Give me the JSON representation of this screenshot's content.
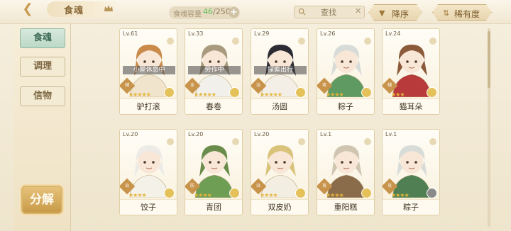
{
  "header": {
    "title": "食魂",
    "capacity_label": "食魂容量",
    "capacity_current": "46",
    "capacity_total": "/250",
    "search_text": "查找",
    "sort_order_label": "降序",
    "sort_rarity_label": "稀有度"
  },
  "sidebar": {
    "tabs": [
      {
        "label": "食魂",
        "active": true
      },
      {
        "label": "调理",
        "active": false
      },
      {
        "label": "信物",
        "active": false
      }
    ],
    "decompose_label": "分解"
  },
  "cards": [
    {
      "level": "Lv.61",
      "name": "驴打滚",
      "status": "小屋休息中",
      "role": "辅",
      "stars": "★★★★★",
      "rank_color": "#e5c15a",
      "hair": "#c98a4a",
      "outfit": "#f0e4cc"
    },
    {
      "level": "Lv.33",
      "name": "春卷",
      "status": "劳作中",
      "role": "全",
      "stars": "★★★★★",
      "rank_color": "#e5c15a",
      "hair": "#a89a7c",
      "outfit": "#f1f0ea"
    },
    {
      "level": "Lv.29",
      "name": "汤圆",
      "status": "探索出行",
      "role": "治",
      "stars": "★★★★★",
      "rank_color": "#e5c15a",
      "hair": "#2c2a33",
      "outfit": "#f3efe6"
    },
    {
      "level": "Lv.26",
      "name": "粽子",
      "status": "",
      "role": "攻",
      "stars": "★★★★",
      "rank_color": "#e5c15a",
      "hair": "#d8dcd8",
      "outfit": "#5f9a62"
    },
    {
      "level": "Lv.24",
      "name": "猫耳朵",
      "status": "",
      "role": "辅",
      "stars": "★★★",
      "rank_color": "#e5c15a",
      "hair": "#8a5a3a",
      "outfit": "#b83a3a"
    },
    {
      "level": "Lv.20",
      "name": "饺子",
      "status": "",
      "role": "治",
      "stars": "★★★★",
      "rank_color": "#e5c15a",
      "hair": "#ecebe6",
      "outfit": "#f4f1e8"
    },
    {
      "level": "Lv.20",
      "name": "青团",
      "status": "",
      "role": "防",
      "stars": "★★★★",
      "rank_color": "#e5c15a",
      "hair": "#6a8c4a",
      "outfit": "#6e9d54"
    },
    {
      "level": "Lv.20",
      "name": "双皮奶",
      "status": "",
      "role": "治",
      "stars": "★★★★",
      "rank_color": "#e5c15a",
      "hair": "#d9c27a",
      "outfit": "#f3eee2"
    },
    {
      "level": "Lv.1",
      "name": "重阳糕",
      "status": "",
      "role": "攻",
      "stars": "★★★★",
      "rank_color": "#e5c15a",
      "hair": "#cfc5b0",
      "outfit": "#8a6b4a"
    },
    {
      "level": "Lv.1",
      "name": "粽子",
      "status": "",
      "role": "攻",
      "stars": "★★★★",
      "rank_color": "#8a8a8a",
      "hair": "#d8dcd8",
      "outfit": "#4f7f52"
    }
  ]
}
